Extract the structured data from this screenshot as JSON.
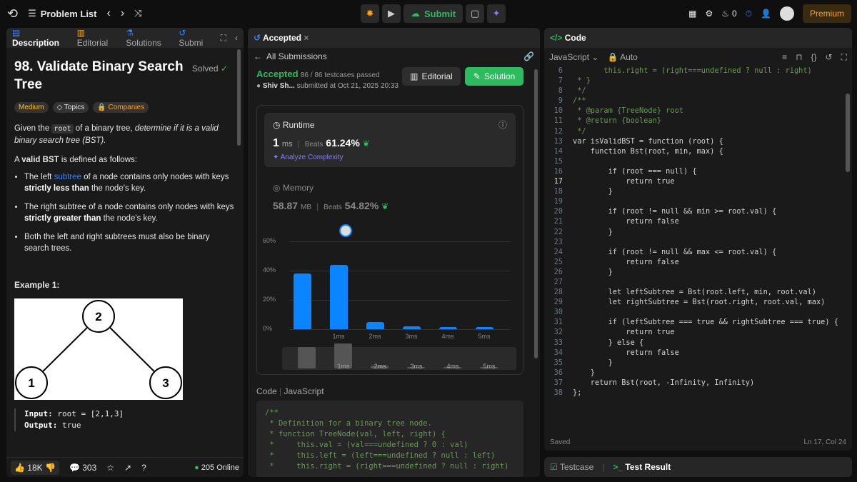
{
  "topbar": {
    "problem_list": "Problem List",
    "submit": "Submit",
    "streak": "0",
    "premium": "Premium"
  },
  "left": {
    "tabs": [
      "Description",
      "Editorial",
      "Solutions",
      "Submi"
    ],
    "title_line1": "98. Validate Binary Search",
    "title_line2": "Tree",
    "solved": "Solved",
    "tags": [
      "Medium",
      "Topics",
      "Companies"
    ],
    "desc_a": "Given the ",
    "desc_code": "root",
    "desc_b": " of a binary tree, ",
    "desc_em": "determine if it is a valid binary search tree (BST).",
    "valid_a": "A ",
    "valid_b": "valid BST",
    "valid_c": " is defined as follows:",
    "b1a": "The left ",
    "b1link": "subtree",
    "b1b": " of a node contains only nodes with keys ",
    "b1c": "strictly less than",
    "b1d": " the node's key.",
    "b2a": "The right subtree of a node contains only nodes with keys ",
    "b2b": "strictly greater than",
    "b2c": " the node's key.",
    "b3": "Both the left and right subtrees must also be binary search trees.",
    "example": "Example 1:",
    "tree_nodes": [
      "2",
      "1",
      "3"
    ],
    "input_label": "Input:",
    "input_val": "root = [2,1,3]",
    "output_label": "Output:",
    "output_val": "true",
    "likes": "18K",
    "comments": "303",
    "online": "205 Online"
  },
  "mid": {
    "tab": "Accepted",
    "back": "All Submissions",
    "status": "Accepted",
    "passed": "86 / 86 testcases passed",
    "user": "Shiv Sh...",
    "submitted": "submitted at Oct 21, 2025 20:33",
    "editorial_btn": "Editorial",
    "solution_btn": "Solution",
    "runtime_label": "Runtime",
    "runtime_val": "1",
    "runtime_unit": "ms",
    "beats": "Beats",
    "runtime_pct": "61.24%",
    "analyze": "Analyze Complexity",
    "memory_label": "Memory",
    "memory_val": "58.87",
    "memory_unit": "MB",
    "memory_pct": "54.82%",
    "code_label": "Code",
    "lang": "JavaScript",
    "snippet": [
      "/**",
      " * Definition for a binary tree node.",
      " * function TreeNode(val, left, right) {",
      " *     this.val = (val===undefined ? 0 : val)",
      " *     this.left = (left===undefined ? null : left)",
      " *     this.right = (right===undefined ? null : right)"
    ]
  },
  "chart_data": {
    "type": "bar",
    "y_ticks": [
      "60%",
      "40%",
      "20%",
      "0%"
    ],
    "ylim": [
      0,
      60
    ],
    "categories": [
      "",
      "1ms",
      "2ms",
      "3ms",
      "4ms",
      "5ms"
    ],
    "values": [
      38,
      44,
      5,
      2,
      1.5,
      1.5
    ]
  },
  "right": {
    "tab": "Code",
    "lang": "JavaScript",
    "auto": "Auto",
    "saved": "Saved",
    "cursor": "Ln 17, Col 24",
    "testcase": "Testcase",
    "test_result": "Test Result",
    "lines": [
      {
        "n": "6",
        "t": "       this.right = (right===undefined ? null : right)"
      },
      {
        "n": "7",
        "t": " * }"
      },
      {
        "n": "8",
        "t": " */"
      },
      {
        "n": "9",
        "t": "/**"
      },
      {
        "n": "10",
        "t": " * @param {TreeNode} root"
      },
      {
        "n": "11",
        "t": " * @return {boolean}"
      },
      {
        "n": "12",
        "t": " */"
      },
      {
        "n": "13",
        "t": "var isValidBST = function (root) {"
      },
      {
        "n": "14",
        "t": "    function Bst(root, min, max) {"
      },
      {
        "n": "15",
        "t": ""
      },
      {
        "n": "16",
        "t": "        if (root === null) {"
      },
      {
        "n": "17",
        "t": "            return true"
      },
      {
        "n": "18",
        "t": "        }"
      },
      {
        "n": "19",
        "t": ""
      },
      {
        "n": "20",
        "t": "        if (root != null && min >= root.val) {"
      },
      {
        "n": "21",
        "t": "            return false"
      },
      {
        "n": "22",
        "t": "        }"
      },
      {
        "n": "23",
        "t": ""
      },
      {
        "n": "24",
        "t": "        if (root != null && max <= root.val) {"
      },
      {
        "n": "25",
        "t": "            return false"
      },
      {
        "n": "26",
        "t": "        }"
      },
      {
        "n": "27",
        "t": ""
      },
      {
        "n": "28",
        "t": "        let leftSubtree = Bst(root.left, min, root.val)"
      },
      {
        "n": "29",
        "t": "        let rightSubtree = Bst(root.right, root.val, max)"
      },
      {
        "n": "30",
        "t": ""
      },
      {
        "n": "31",
        "t": "        if (leftSubtree === true && rightSubtree === true) {"
      },
      {
        "n": "32",
        "t": "            return true"
      },
      {
        "n": "33",
        "t": "        } else {"
      },
      {
        "n": "34",
        "t": "            return false"
      },
      {
        "n": "35",
        "t": "        }"
      },
      {
        "n": "36",
        "t": "    }"
      },
      {
        "n": "37",
        "t": "    return Bst(root, -Infinity, Infinity)"
      },
      {
        "n": "38",
        "t": "};"
      }
    ]
  }
}
